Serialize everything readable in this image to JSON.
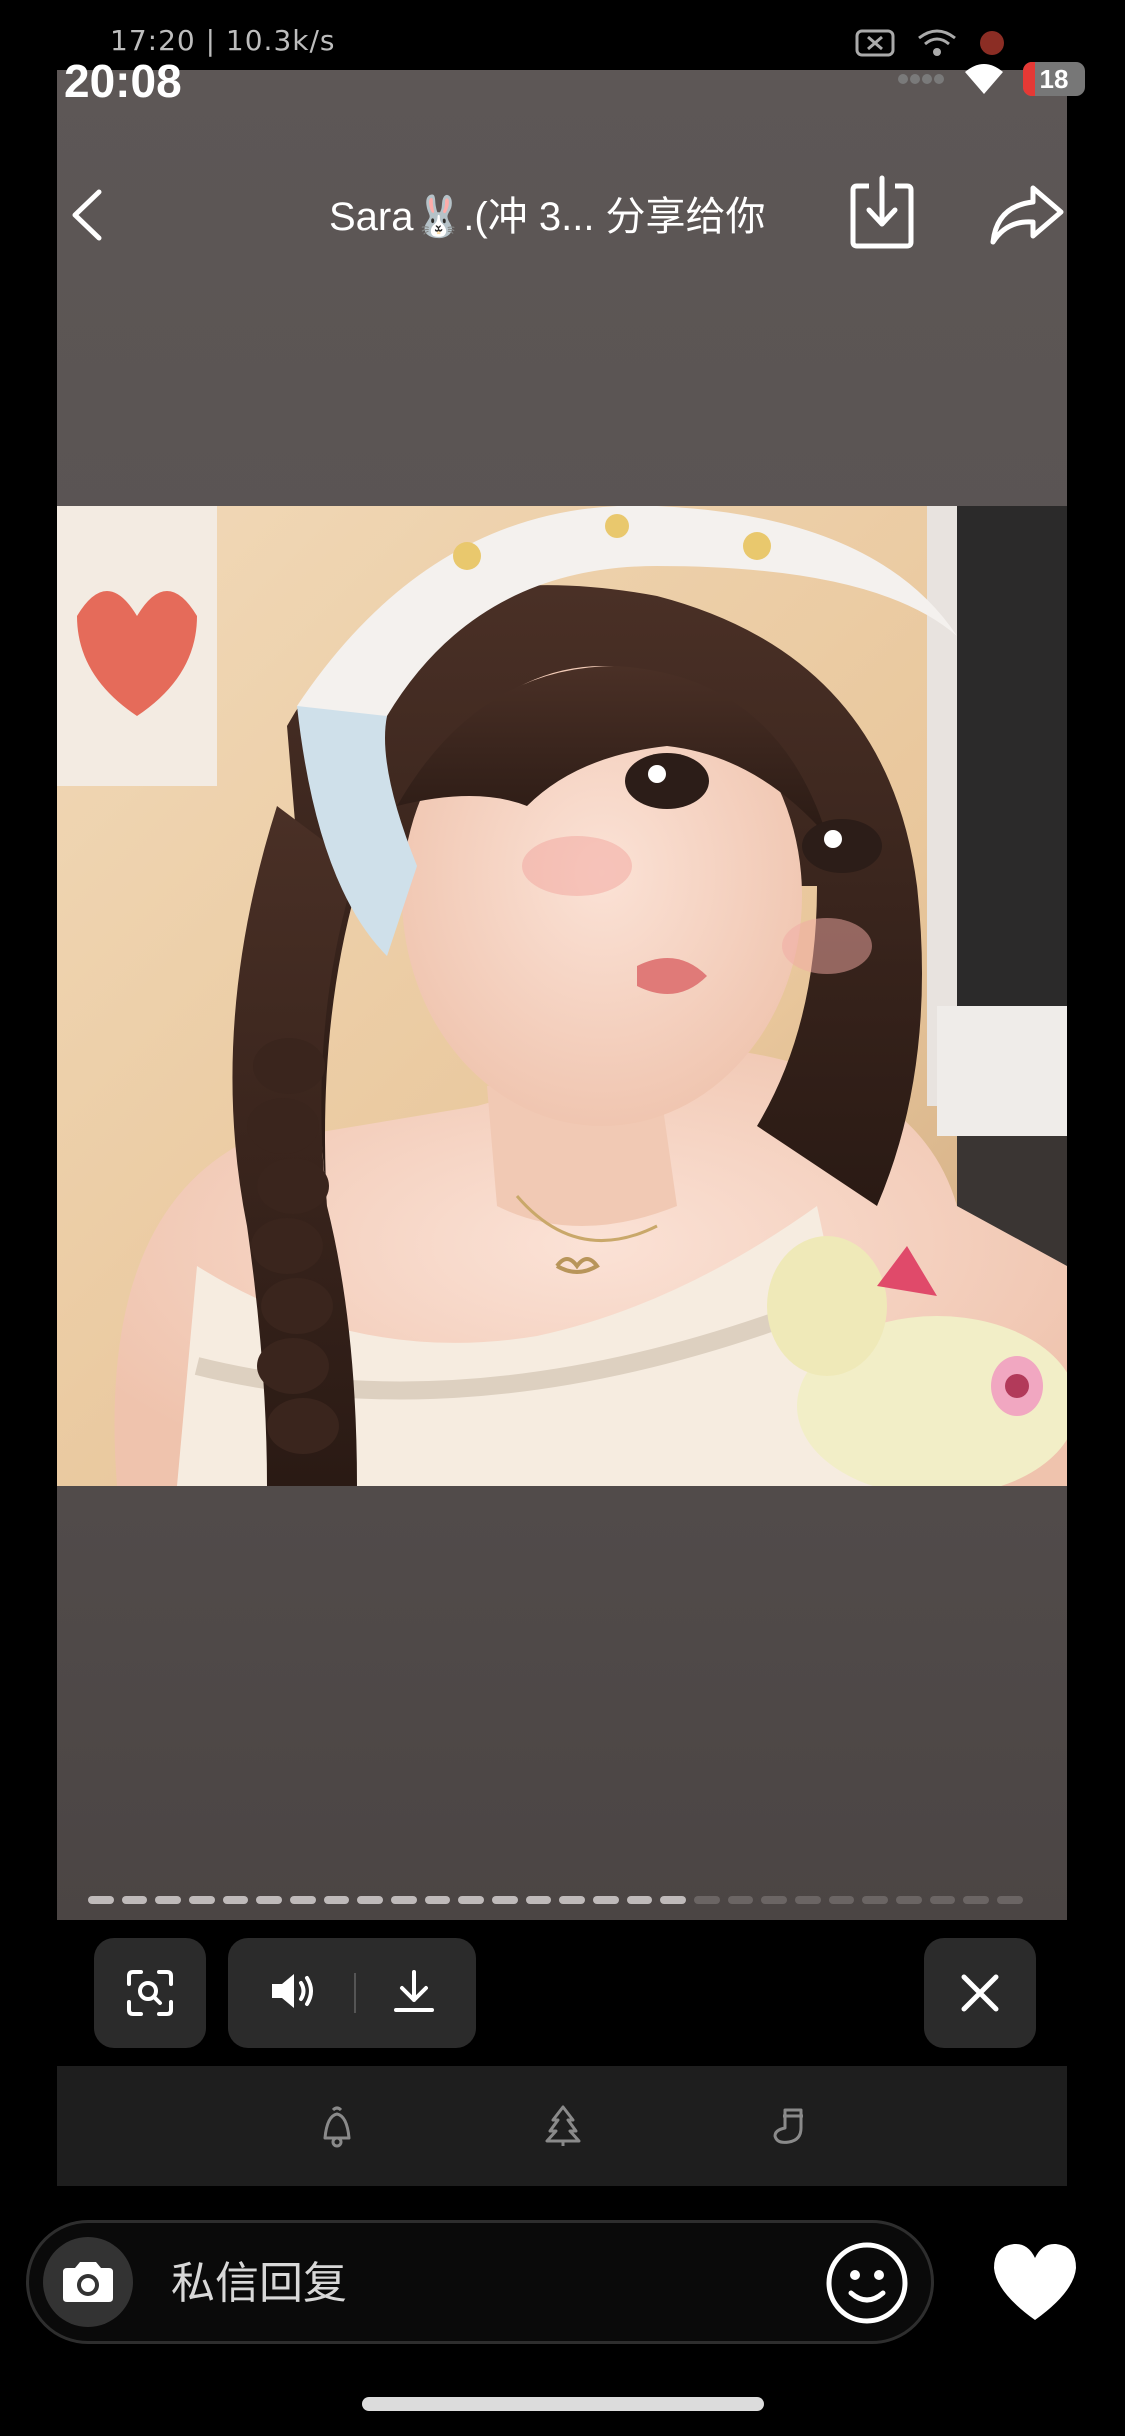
{
  "inner_status": {
    "text": "17:20 | 10.3k/s"
  },
  "status": {
    "time": "20:08",
    "battery": "18"
  },
  "story": {
    "title": "Sara🐰.(冲 3... 分享给你",
    "photo_alt": "",
    "progress": {
      "total": 28,
      "current": 18
    }
  },
  "icons": {
    "back": "chevron-left-icon",
    "download": "download-icon",
    "share": "share-icon",
    "scan": "scan-icon",
    "volume": "volume-icon",
    "save": "download-icon",
    "close": "close-icon",
    "camera": "camera-icon",
    "emoji": "emoji-icon",
    "heart": "heart-icon"
  },
  "reactions": [
    "bell-icon",
    "tree-icon",
    "stocking-icon"
  ],
  "reply": {
    "placeholder": "私信回复"
  },
  "colors": {
    "story_bg": "#575150",
    "button_bg": "#2b2b2b",
    "reaction_bar": "#1e1e1e"
  }
}
